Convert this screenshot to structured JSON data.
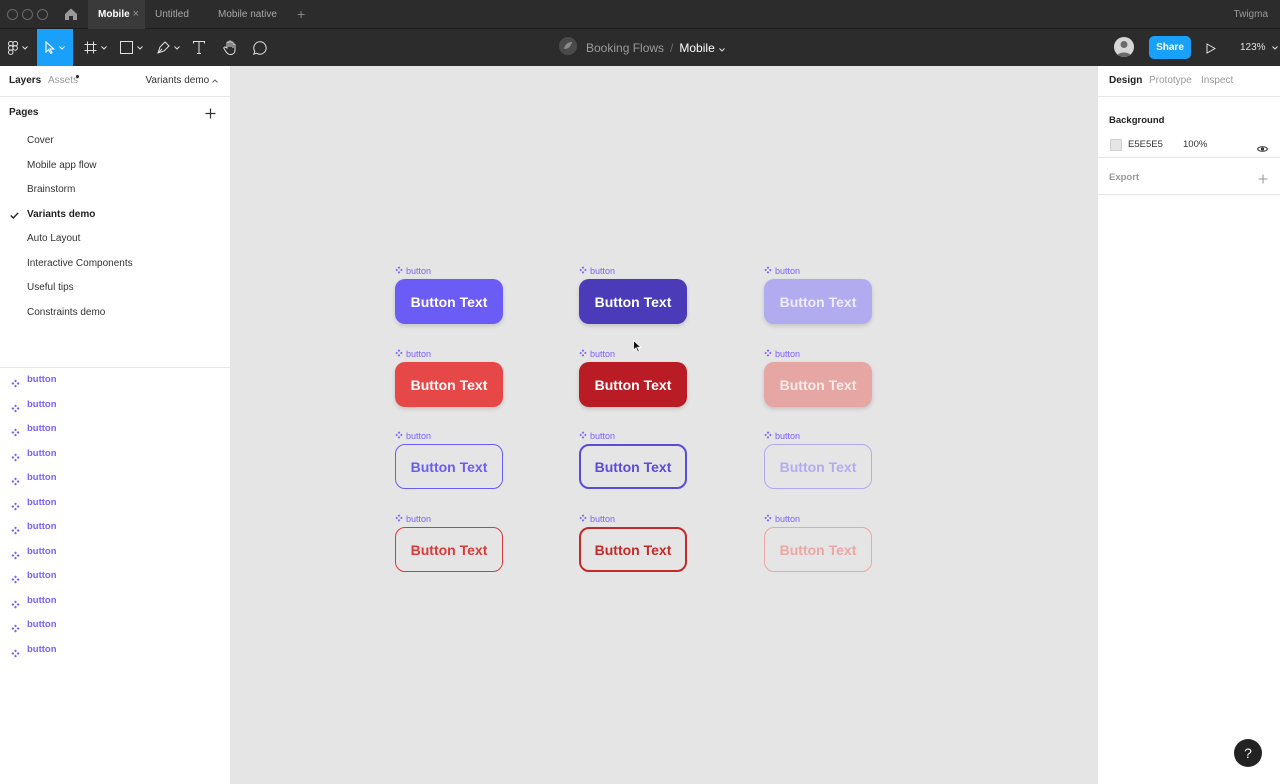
{
  "app": {
    "name": "Twigma"
  },
  "tabs": [
    {
      "label": "Mobile",
      "active": true,
      "close": "×"
    },
    {
      "label": "Untitled",
      "active": false
    },
    {
      "label": "Mobile native",
      "active": false
    }
  ],
  "tab_add": "+",
  "breadcrumb": {
    "project": "Booking Flows",
    "separator": "/",
    "file": "Mobile"
  },
  "toolbar": {
    "share_label": "Share",
    "zoom": "123%"
  },
  "left_panel": {
    "tabs": {
      "layers": "Layers",
      "assets": "Assets"
    },
    "current_page_select": "Variants demo",
    "pages_title": "Pages",
    "pages": [
      "Cover",
      "Mobile app flow",
      "Brainstorm",
      "Variants demo",
      "Auto Layout",
      "Interactive Components",
      "Useful tips",
      "Constraints demo"
    ],
    "current_page": "Variants demo",
    "layers": [
      "button",
      "button",
      "button",
      "button",
      "button",
      "button",
      "button",
      "button",
      "button",
      "button",
      "button",
      "button"
    ]
  },
  "canvas": {
    "component_label": "button",
    "button_text": "Button Text",
    "rows": [
      [
        {
          "style": "solid",
          "bg": "#6b5cf6",
          "fg": "#ffffff",
          "border": "none"
        },
        {
          "style": "solid",
          "bg": "#4b3bb8",
          "fg": "#ffffff",
          "border": "none"
        },
        {
          "style": "solid",
          "bg": "#b3abf0",
          "fg": "#eeeaff",
          "border": "none"
        }
      ],
      [
        {
          "style": "solid",
          "bg": "#e64848",
          "fg": "#ffffff",
          "border": "none"
        },
        {
          "style": "solid",
          "bg": "#b91c24",
          "fg": "#ffffff",
          "border": "none"
        },
        {
          "style": "solid",
          "bg": "#e6a6a3",
          "fg": "#fbeaea",
          "border": "none"
        }
      ],
      [
        {
          "style": "outline",
          "bg": "transparent",
          "fg": "#6b5cf6",
          "border": "1px solid #6b5cf6"
        },
        {
          "style": "outline",
          "bg": "transparent",
          "fg": "#5a4bd8",
          "border": "2px solid #5a4bd8"
        },
        {
          "style": "outline",
          "bg": "transparent",
          "fg": "#b3abf0",
          "border": "1px solid #b3abf0"
        }
      ],
      [
        {
          "style": "outline",
          "bg": "transparent",
          "fg": "#d93a3a",
          "border": "1px solid #d93a3a"
        },
        {
          "style": "outline",
          "bg": "transparent",
          "fg": "#c42a2a",
          "border": "2px solid #c42a2a"
        },
        {
          "style": "outline",
          "bg": "transparent",
          "fg": "#eba7a4",
          "border": "1px solid #eba7a4"
        }
      ]
    ]
  },
  "right_panel": {
    "tabs": {
      "design": "Design",
      "prototype": "Prototype",
      "inspect": "Inspect"
    },
    "background_title": "Background",
    "background_hex": "E5E5E5",
    "background_opacity": "100%",
    "export_title": "Export"
  },
  "help": "?",
  "colors": {
    "accent": "#18a0fb",
    "component": "#7b61ff",
    "chrome": "#2c2c2c"
  }
}
